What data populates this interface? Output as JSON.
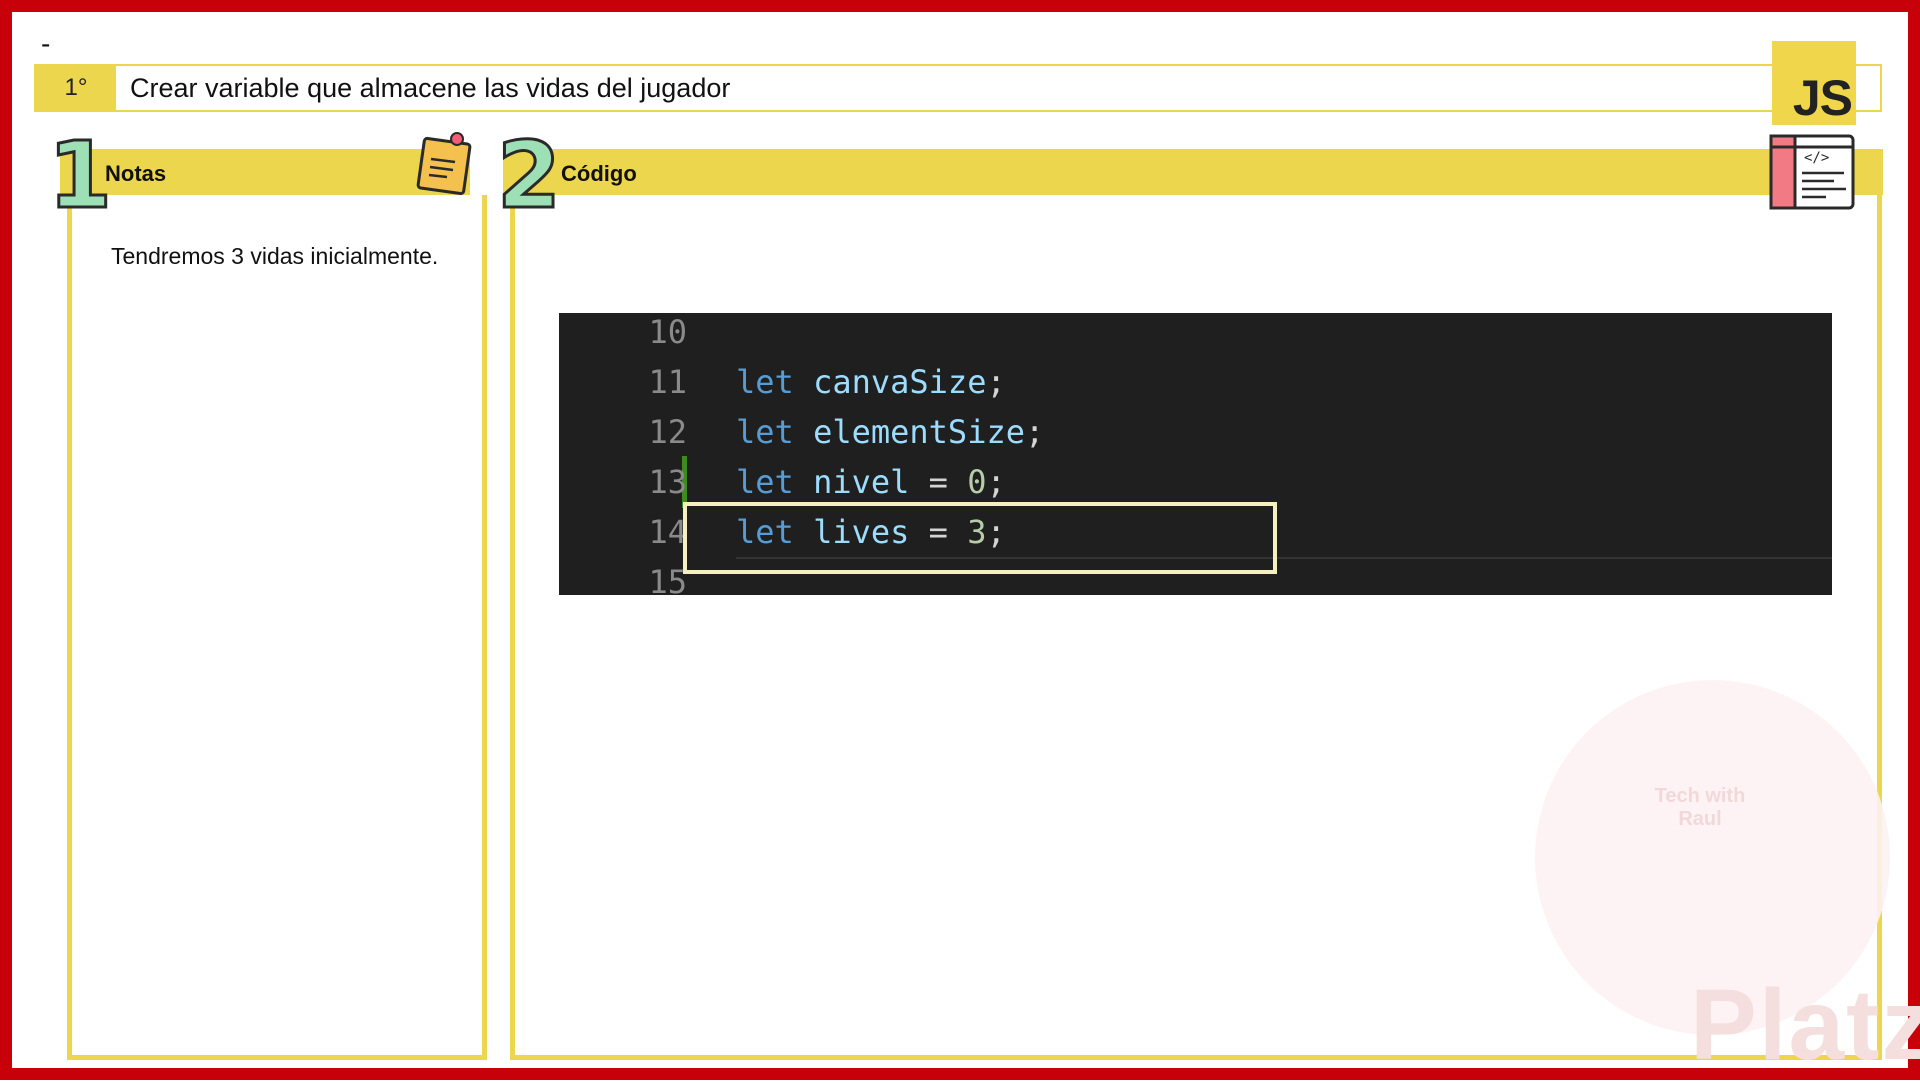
{
  "header": {
    "dash": "-",
    "step_number": "1°",
    "step_text": "Crear variable que almacene las vidas del jugador",
    "badge": "JS"
  },
  "notes_panel": {
    "number": "1",
    "title": "Notas",
    "icon": "sticky-note-icon",
    "text": "Tendremos 3 vidas inicialmente."
  },
  "code_panel": {
    "number": "2",
    "title": "Código",
    "icon": "code-window-icon",
    "lines": [
      {
        "num": "10",
        "code": ""
      },
      {
        "num": "11",
        "code": "let canvaSize;"
      },
      {
        "num": "12",
        "code": "let elementSize;"
      },
      {
        "num": "13",
        "code": "let nivel = 0;"
      },
      {
        "num": "14",
        "code": "let lives = 3;"
      },
      {
        "num": "15",
        "code": ""
      }
    ]
  },
  "watermark": {
    "brand": "Platzi",
    "logo_text": "Tech with Raul"
  },
  "colors": {
    "frame": "#c8000a",
    "accent_yellow": "#ecd64e",
    "code_bg": "#1f1f1f",
    "keyword": "#569cd6",
    "identifier": "#9cdcfe",
    "number": "#b5cea8"
  }
}
